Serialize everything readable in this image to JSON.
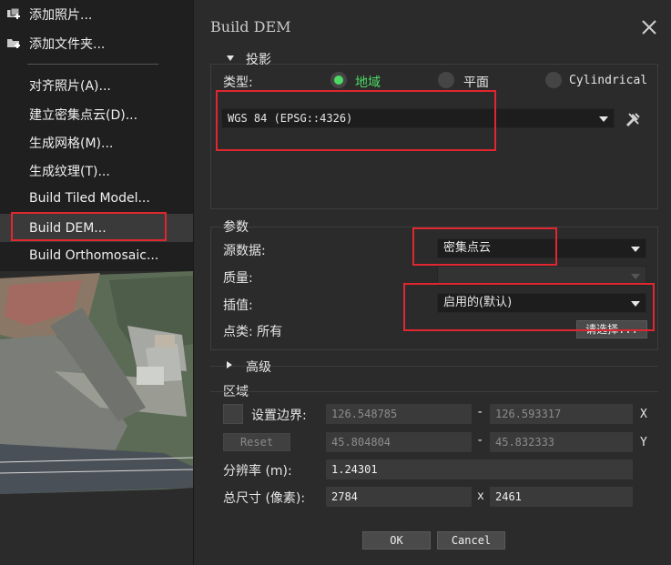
{
  "menu": {
    "items": [
      {
        "label": "添加照片..."
      },
      {
        "label": "添加文件夹..."
      },
      {
        "label": "对齐照片(A)..."
      },
      {
        "label": "建立密集点云(D)..."
      },
      {
        "label": "生成网格(M)..."
      },
      {
        "label": "生成纹理(T)..."
      },
      {
        "label": "Build Tiled Model..."
      },
      {
        "label": "Build DEM..."
      },
      {
        "label": "Build Orthomosaic..."
      }
    ]
  },
  "dialog": {
    "title": "Build DEM",
    "projection": {
      "header": "投影",
      "type_label": "类型:",
      "options": [
        {
          "label": "地域",
          "selected": true
        },
        {
          "label": "平面",
          "selected": false
        },
        {
          "label": "Cylindrical",
          "selected": false
        }
      ],
      "crs_value": "WGS 84 (EPSG::4326)"
    },
    "params": {
      "header": "参数",
      "source_label": "源数据:",
      "source_value": "密集点云",
      "quality_label": "质量:",
      "quality_value": "",
      "interp_label": "插值:",
      "interp_value": "启用的(默认)",
      "point_class_label": "点类: 所有",
      "select_button": "请选择..."
    },
    "advanced": {
      "header": "高级"
    },
    "region": {
      "header": "区域",
      "setbounds_label": "设置边界:",
      "reset_button": "Reset",
      "x_min": "126.548785",
      "x_max": "126.593317",
      "x_axis": "X",
      "y_min": "45.804804",
      "y_max": "45.832333",
      "y_axis": "Y",
      "dash": "-",
      "resolution_label": "分辨率 (m):",
      "resolution_value": "1.24301",
      "total_size_label": "总尺寸 (像素):",
      "width_px": "2784",
      "size_sep": "x",
      "height_px": "2461"
    },
    "ok_button": "OK",
    "cancel_button": "Cancel"
  },
  "colors": {
    "accent_green": "#4cd964",
    "highlight_red": "#e0262f",
    "bg": "#2b2b2b"
  }
}
